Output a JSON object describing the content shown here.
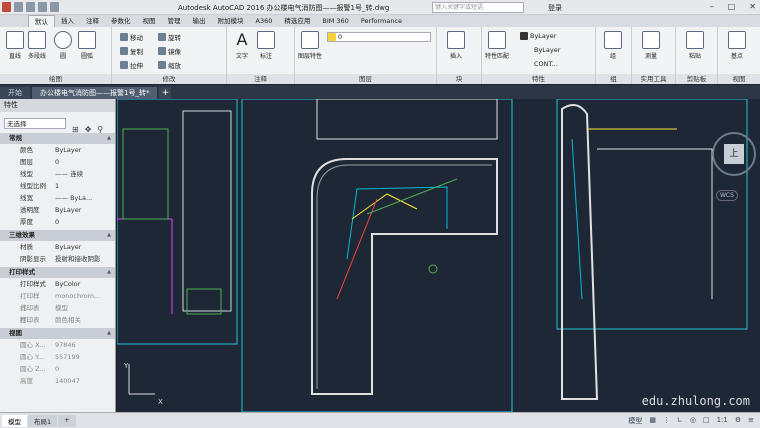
{
  "titlebar": {
    "title": "Autodesk AutoCAD 2016    办公楼电气消防图——报警1号_转.dwg",
    "search_placeholder": "键入关键字或短语",
    "login": "登录"
  },
  "ribbon_tabs": [
    "默认",
    "插入",
    "注释",
    "参数化",
    "视图",
    "管理",
    "输出",
    "附加模块",
    "A360",
    "精选应用",
    "BIM 360",
    "Performance"
  ],
  "panels": {
    "draw": {
      "title": "绘图",
      "line": "直线",
      "polyline": "多段线",
      "circle": "圆",
      "arc": "圆弧"
    },
    "modify": {
      "title": "修改",
      "move": "移动",
      "rotate": "旋转",
      "copy": "复制",
      "mirror": "镜像",
      "stretch": "拉伸",
      "scale": "缩放"
    },
    "annotation": {
      "title": "注释",
      "text": "文字",
      "dim": "标注"
    },
    "layers": {
      "title": "图层",
      "props": "图层特性",
      "value": "0"
    },
    "block": {
      "title": "块",
      "insert": "插入"
    },
    "properties": {
      "title": "特性",
      "match": "特性匹配",
      "bylayer1": "ByLayer",
      "bylayer2": "ByLayer",
      "cont": "CONT..."
    },
    "groups": {
      "title": "组",
      "group": "组"
    },
    "utilities": {
      "title": "实用工具",
      "measure": "测量"
    },
    "clipboard": {
      "title": "剪贴板",
      "paste": "粘贴"
    },
    "view": {
      "title": "视图",
      "base": "基点"
    }
  },
  "doc_tabs": {
    "start": "开始",
    "file": "办公楼电气消防图——报警1号_转*"
  },
  "properties_palette": {
    "title": "特性",
    "selection": "无选择",
    "sections": [
      {
        "name": "常规",
        "rows": [
          [
            "颜色",
            "ByLayer"
          ],
          [
            "图层",
            "0"
          ],
          [
            "线型",
            "—— 连续"
          ],
          [
            "线型比例",
            "1"
          ],
          [
            "线宽",
            "—— ByLa..."
          ],
          [
            "透明度",
            "ByLayer"
          ],
          [
            "厚度",
            "0"
          ]
        ]
      },
      {
        "name": "三维效果",
        "rows": [
          [
            "材质",
            "ByLayer"
          ],
          [
            "阴影显示",
            "投射和接收阴影"
          ]
        ]
      },
      {
        "name": "打印样式",
        "rows": [
          [
            "打印样式",
            "ByColor"
          ],
          [
            "打印样式...",
            "monochrom..."
          ],
          [
            "打印表附...",
            "模型"
          ],
          [
            "打印表类...",
            "颜色相关"
          ]
        ]
      },
      {
        "name": "视图",
        "rows": [
          [
            "圆心 X...",
            "97846"
          ],
          [
            "圆心 Y...",
            "557199"
          ],
          [
            "圆心 Z...",
            "0"
          ],
          [
            "高度",
            "140047"
          ]
        ]
      }
    ]
  },
  "layout_tabs": [
    "模型",
    "布局1"
  ],
  "status": {
    "model": "模型",
    "scale": "1:1"
  },
  "navcube": {
    "face": "上",
    "wcs": "WCS"
  },
  "ucs": {
    "x": "X",
    "y": "Y"
  },
  "watermark": "edu.zhulong.com",
  "colors": {
    "canvas": "#1e2736",
    "drawing_frame": "#26c6da",
    "walls": "#e0e0e0",
    "magenta": "#e040fb",
    "green": "#4caf50",
    "cyan": "#00bcd4"
  }
}
